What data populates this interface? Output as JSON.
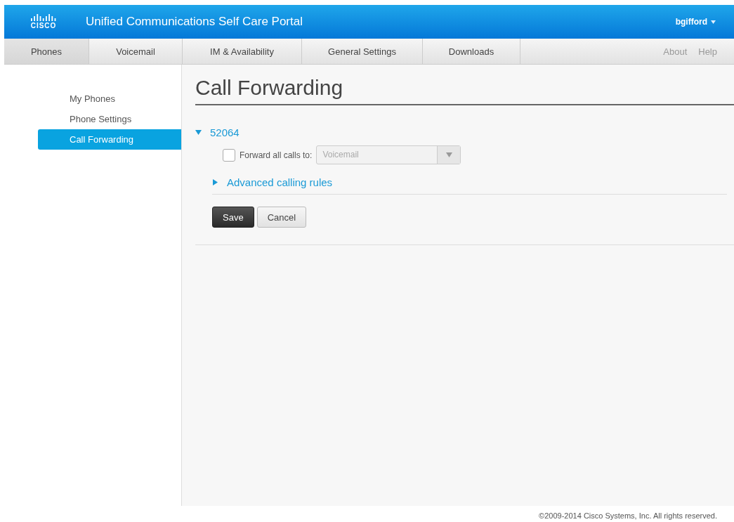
{
  "header": {
    "logo_text": "CISCO",
    "title": "Unified Communications Self Care Portal",
    "user": "bgifford"
  },
  "tabs": [
    {
      "label": "Phones",
      "selected": true
    },
    {
      "label": "Voicemail",
      "selected": false
    },
    {
      "label": "IM & Availability",
      "selected": false
    },
    {
      "label": "General Settings",
      "selected": false
    },
    {
      "label": "Downloads",
      "selected": false
    }
  ],
  "nav_links": [
    "About",
    "Help"
  ],
  "sidebar": {
    "items": [
      {
        "label": "My Phones",
        "selected": false
      },
      {
        "label": "Phone Settings",
        "selected": false
      },
      {
        "label": "Call Forwarding",
        "selected": true
      }
    ]
  },
  "main": {
    "title": "Call Forwarding",
    "line": {
      "number": "52064",
      "expanded": true,
      "forward_all": {
        "label": "Forward all calls to:",
        "checked": false,
        "value": "Voicemail",
        "disabled": true
      },
      "advanced": {
        "label": "Advanced calling rules",
        "expanded": false
      }
    },
    "buttons": [
      {
        "label": "Save",
        "kind": "primary"
      },
      {
        "label": "Cancel",
        "kind": "secondary"
      }
    ]
  },
  "footer": "©2009-2014 Cisco Systems, Inc. All rights reserved."
}
